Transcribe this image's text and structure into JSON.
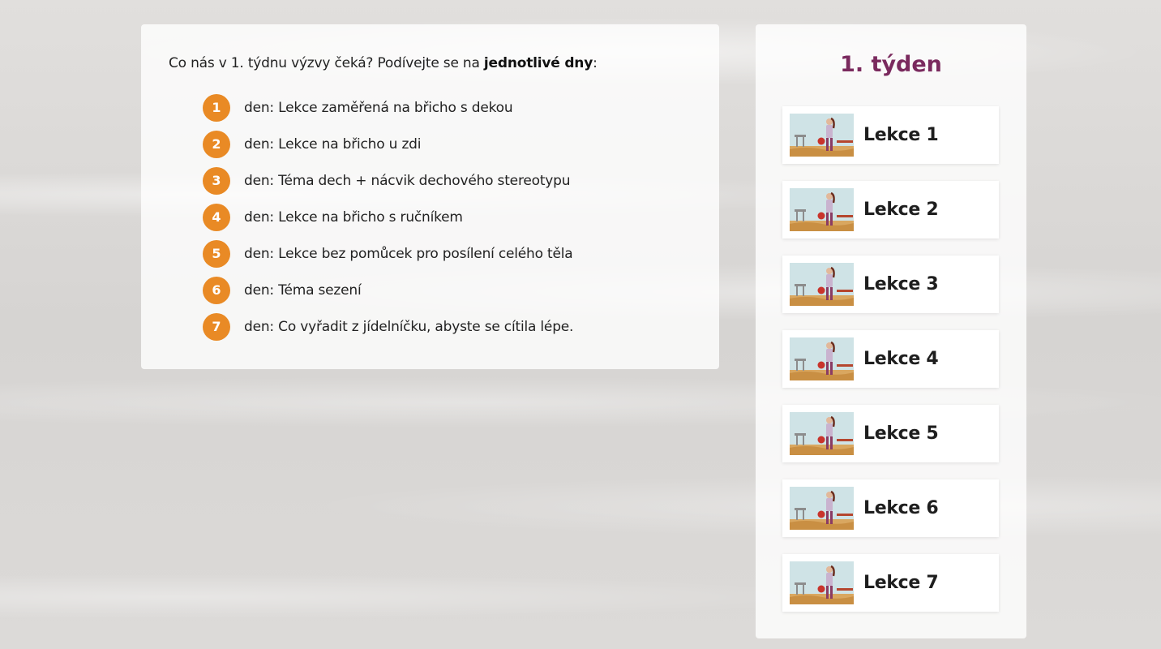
{
  "intro": {
    "before": "Co nás v 1. týdnu výzvy čeká? Podívejte se na ",
    "bold": "jednotlivé dny",
    "after": ":"
  },
  "days": [
    {
      "num": "1",
      "text": "den: Lekce zaměřená na břicho s dekou"
    },
    {
      "num": "2",
      "text": "den: Lekce na břicho u zdi"
    },
    {
      "num": "3",
      "text": "den: Téma dech + nácvik dechového stereotypu"
    },
    {
      "num": "4",
      "text": "den: Lekce na břicho s ručníkem"
    },
    {
      "num": "5",
      "text": "den: Lekce bez pomůcek pro posílení celého těla"
    },
    {
      "num": "6",
      "text": "den: Téma sezení"
    },
    {
      "num": "7",
      "text": "den: Co vyřadit z jídelníčku, abyste se cítila lépe."
    }
  ],
  "sidebar": {
    "title": "1. týden",
    "lessons": [
      {
        "label": "Lekce 1"
      },
      {
        "label": "Lekce 2"
      },
      {
        "label": "Lekce 3"
      },
      {
        "label": "Lekce 4"
      },
      {
        "label": "Lekce 5"
      },
      {
        "label": "Lekce 6"
      },
      {
        "label": "Lekce 7"
      }
    ]
  },
  "colors": {
    "badge": "#e98a25",
    "title": "#7a2a5e"
  }
}
